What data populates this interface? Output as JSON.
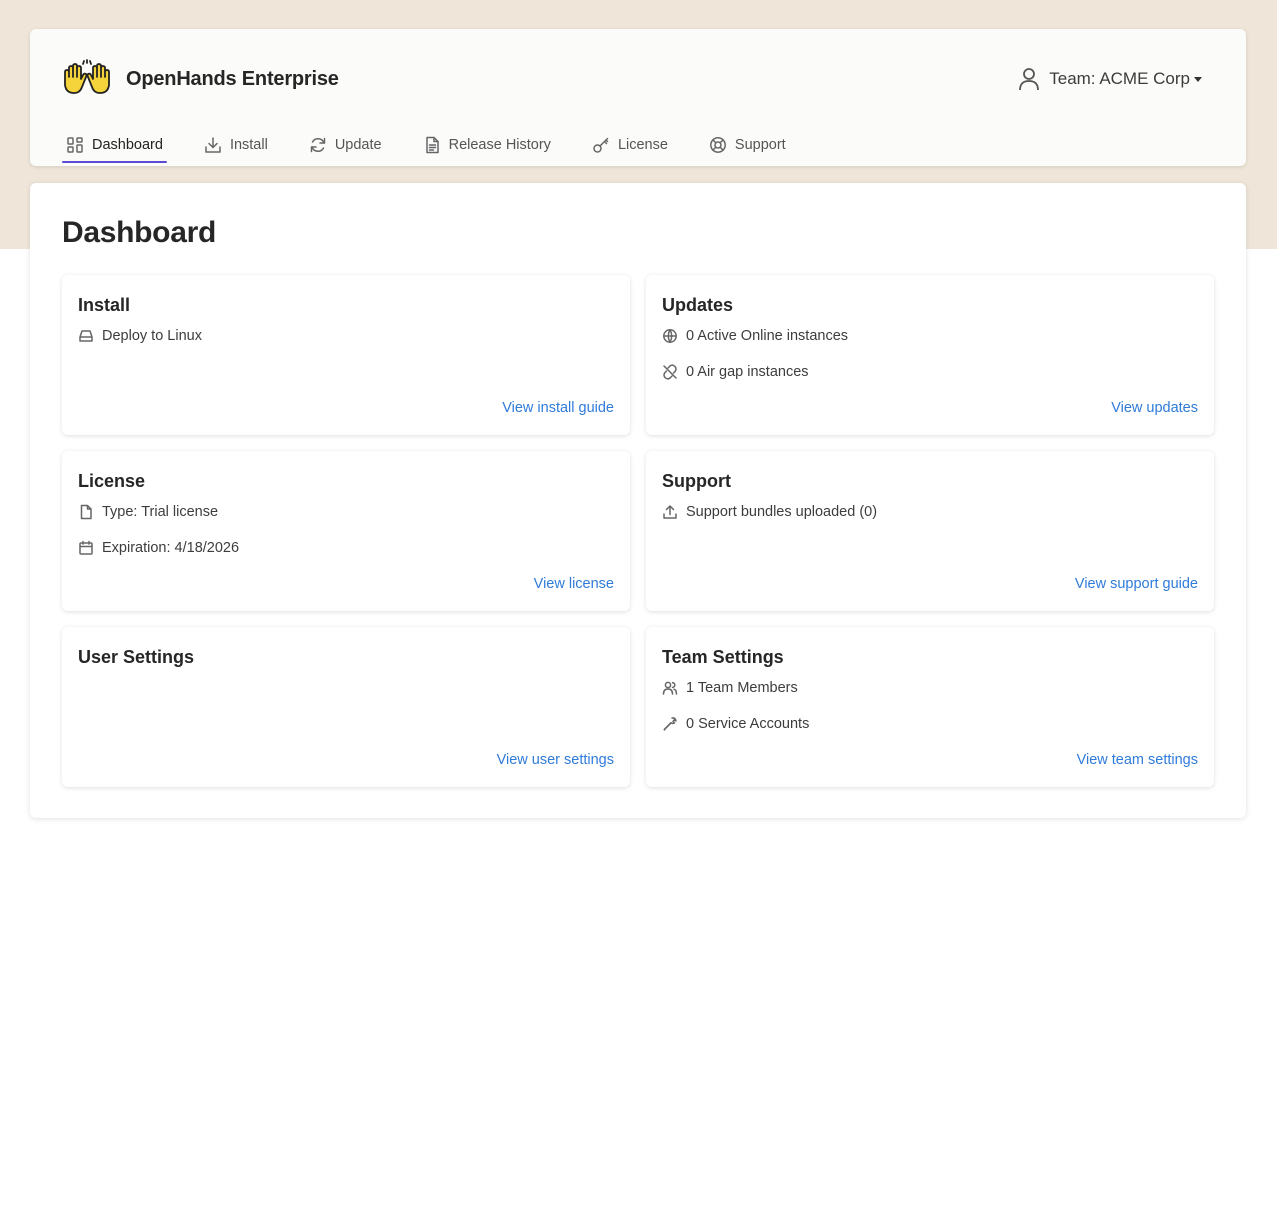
{
  "app": {
    "name": "OpenHands Enterprise"
  },
  "team": {
    "label": "Team: ACME Corp"
  },
  "nav": {
    "items": [
      {
        "label": "Dashboard",
        "icon": "grid-icon"
      },
      {
        "label": "Install",
        "icon": "download-icon"
      },
      {
        "label": "Update",
        "icon": "refresh-icon"
      },
      {
        "label": "Release History",
        "icon": "document-icon"
      },
      {
        "label": "License",
        "icon": "key-icon"
      },
      {
        "label": "Support",
        "icon": "lifebuoy-icon"
      }
    ],
    "active": "Dashboard"
  },
  "page": {
    "title": "Dashboard"
  },
  "cards": {
    "install": {
      "title": "Install",
      "rows": [
        {
          "icon": "hard-drive-icon",
          "text": "Deploy to Linux"
        }
      ],
      "link": "View install guide"
    },
    "updates": {
      "title": "Updates",
      "rows": [
        {
          "icon": "globe-icon",
          "text": "0 Active Online instances"
        },
        {
          "icon": "unlink-icon",
          "text": "0 Air gap instances"
        }
      ],
      "link": "View updates"
    },
    "license": {
      "title": "License",
      "rows": [
        {
          "icon": "file-icon",
          "text": "Type: Trial license"
        },
        {
          "icon": "calendar-icon",
          "text": "Expiration: 4/18/2026"
        }
      ],
      "link": "View license"
    },
    "support": {
      "title": "Support",
      "rows": [
        {
          "icon": "upload-icon",
          "text": "Support bundles uploaded (0)"
        }
      ],
      "link": "View support guide"
    },
    "user_settings": {
      "title": "User Settings",
      "link": "View user settings"
    },
    "team_settings": {
      "title": "Team Settings",
      "rows": [
        {
          "icon": "users-icon",
          "text": "1 Team Members"
        },
        {
          "icon": "wrench-icon",
          "text": "0 Service Accounts"
        }
      ],
      "link": "View team settings"
    }
  },
  "colors": {
    "top_band": "#efe6d9",
    "accent": "#5b4bd4",
    "link": "#2f7bd9",
    "logo_yellow": "#f5d33a"
  }
}
